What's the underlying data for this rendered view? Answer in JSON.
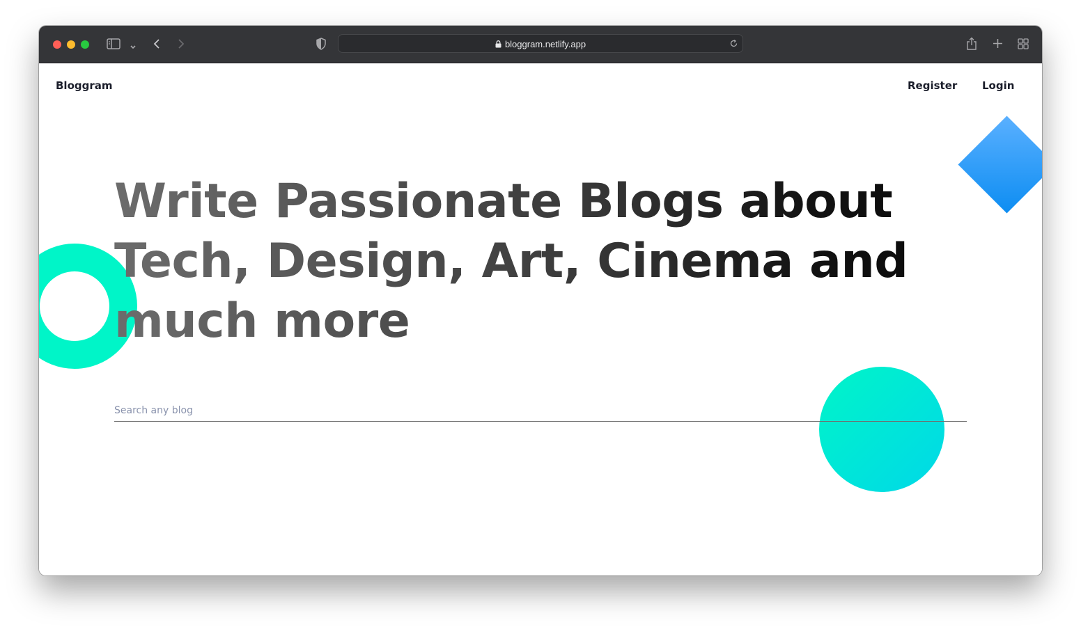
{
  "browser": {
    "url": "bloggram.netlify.app",
    "traffic_light_colors": {
      "close": "#ff5f57",
      "minimize": "#febc2e",
      "maximize": "#28c840"
    },
    "icons": [
      "sidebar-icon",
      "chevron-down-icon",
      "back-icon",
      "forward-icon",
      "shield-icon",
      "lock-icon",
      "reload-icon",
      "share-icon",
      "new-tab-icon",
      "tab-overview-icon"
    ]
  },
  "nav": {
    "brand": "Bloggram",
    "register_label": "Register",
    "login_label": "Login"
  },
  "hero": {
    "headline": "Write Passionate Blogs about Tech, Design, Art, Cinema and much more",
    "search_placeholder": "Search any blog"
  },
  "colors": {
    "ring": "#00f5c8",
    "diamond": "#1e96f5",
    "blob": "#00e5d8"
  }
}
